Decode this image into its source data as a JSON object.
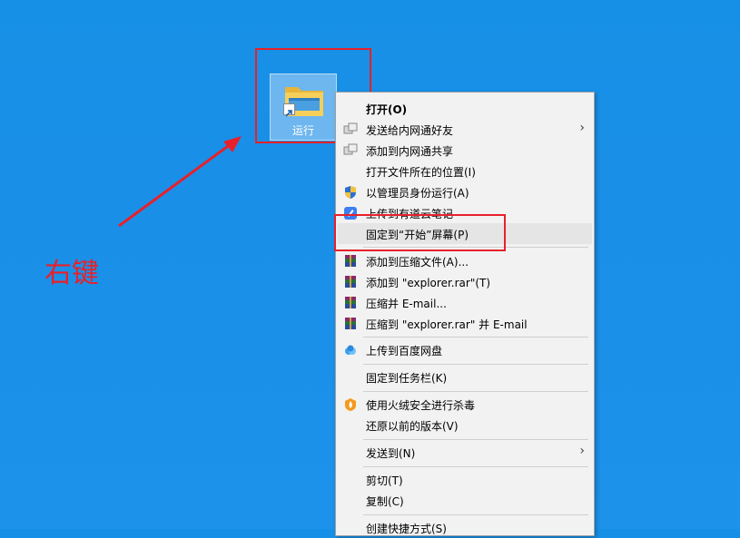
{
  "desktop_icon": {
    "label": "运行",
    "icon": "folder-shortcut-icon"
  },
  "annotation": {
    "text": "右键",
    "color": "#e8202a"
  },
  "menu": {
    "items": [
      {
        "label": "打开(O)",
        "icon": "",
        "bold": true
      },
      {
        "label": "发送给内网通好友",
        "icon": "lan-share-icon",
        "submenu": true
      },
      {
        "label": "添加到内网通共享",
        "icon": "lan-share-icon"
      },
      {
        "label": "打开文件所在的位置(I)",
        "icon": ""
      },
      {
        "label": "以管理员身份运行(A)",
        "icon": "uac-shield-icon"
      },
      {
        "label": "上传到有道云笔记",
        "icon": "youdao-note-icon"
      },
      {
        "label": "固定到“开始”屏幕(P)",
        "icon": "",
        "highlighted": true
      },
      {
        "label": "添加到压缩文件(A)...",
        "icon": "winrar-icon"
      },
      {
        "label": "添加到 \"explorer.rar\"(T)",
        "icon": "winrar-icon"
      },
      {
        "label": "压缩并 E-mail...",
        "icon": "winrar-icon"
      },
      {
        "label": "压缩到 \"explorer.rar\" 并 E-mail",
        "icon": "winrar-icon"
      },
      {
        "label": "上传到百度网盘",
        "icon": "baidu-netdisk-icon"
      },
      {
        "label": "固定到任务栏(K)",
        "icon": ""
      },
      {
        "label": "使用火绒安全进行杀毒",
        "icon": "huorong-icon"
      },
      {
        "label": "还原以前的版本(V)",
        "icon": ""
      },
      {
        "label": "发送到(N)",
        "icon": "",
        "submenu": true
      },
      {
        "label": "剪切(T)",
        "icon": ""
      },
      {
        "label": "复制(C)",
        "icon": ""
      },
      {
        "label": "创建快捷方式(S)",
        "icon": ""
      }
    ]
  }
}
